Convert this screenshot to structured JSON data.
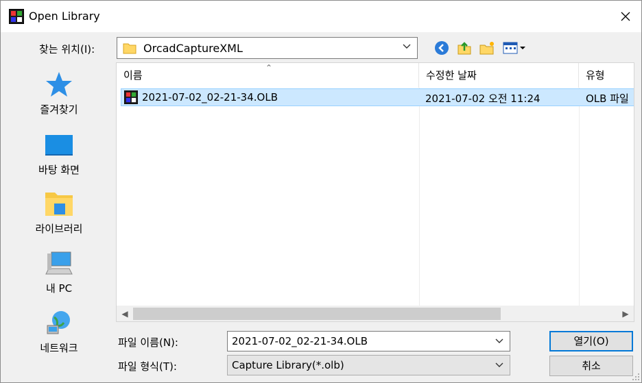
{
  "window": {
    "title": "Open Library"
  },
  "lookin": {
    "label": "찾는 위치(I):",
    "value": "OrcadCaptureXML"
  },
  "places": [
    {
      "label": "즐겨찾기",
      "icon": "star-icon"
    },
    {
      "label": "바탕 화면",
      "icon": "desktop-icon"
    },
    {
      "label": "라이브러리",
      "icon": "library-folder-icon"
    },
    {
      "label": "내 PC",
      "icon": "computer-icon"
    },
    {
      "label": "네트워크",
      "icon": "network-icon"
    }
  ],
  "filelist": {
    "columns": [
      "이름",
      "수정한 날짜",
      "유형"
    ],
    "rows": [
      {
        "name": "2021-07-02_02-21-34.OLB",
        "modified": "2021-07-02 오전 11:24",
        "type": "OLB 파일"
      }
    ]
  },
  "filename": {
    "label": "파일 이름(N):",
    "value": "2021-07-02_02-21-34.OLB"
  },
  "filetype": {
    "label": "파일 형식(T):",
    "value": "Capture Library(*.olb)"
  },
  "buttons": {
    "open": "열기(O)",
    "cancel": "취소"
  },
  "colors": {
    "selection": "#cce8ff",
    "selection_border": "#99d1ff",
    "accent": "#0078d7"
  }
}
